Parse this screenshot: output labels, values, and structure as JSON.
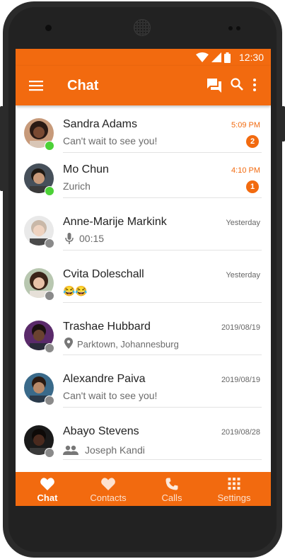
{
  "status_bar": {
    "time": "12:30"
  },
  "app_bar": {
    "title": "Chat"
  },
  "colors": {
    "accent": "#f26a0f",
    "online": "#4cd137",
    "offline": "#8a8a8a"
  },
  "chats": [
    {
      "name": "Sandra Adams",
      "message": "Can't wait to see you!",
      "time": "5:09 PM",
      "unread": "2",
      "status": "online",
      "message_icon": ""
    },
    {
      "name": "Mo Chun",
      "message": "Zurich",
      "time": "4:10 PM",
      "unread": "1",
      "status": "online",
      "message_icon": ""
    },
    {
      "name": "Anne-Marije Markink",
      "message": "00:15",
      "time": "Yesterday",
      "unread": "",
      "status": "offline",
      "message_icon": "mic-icon"
    },
    {
      "name": "Cvita Doleschall",
      "message": "😂😂",
      "time": "Yesterday",
      "unread": "",
      "status": "offline",
      "message_icon": ""
    },
    {
      "name": "Trashae Hubbard",
      "message": "Parktown, Johannesburg",
      "time": "2019/08/19",
      "unread": "",
      "status": "offline",
      "message_icon": "location-pin-icon"
    },
    {
      "name": "Alexandre Paiva",
      "message": "Can't wait to see you!",
      "time": "2019/08/19",
      "unread": "",
      "status": "offline",
      "message_icon": ""
    },
    {
      "name": "Abayo Stevens",
      "message": "Joseph Kandi",
      "time": "2019/08/28",
      "unread": "",
      "status": "offline",
      "message_icon": "group-icon"
    }
  ],
  "bottom_nav": [
    {
      "label": "Chat",
      "icon": "heart-icon",
      "active": true
    },
    {
      "label": "Contacts",
      "icon": "heart-icon",
      "active": false
    },
    {
      "label": "Calls",
      "icon": "phone-icon",
      "active": false
    },
    {
      "label": "Settings",
      "icon": "grid-icon",
      "active": false
    }
  ]
}
